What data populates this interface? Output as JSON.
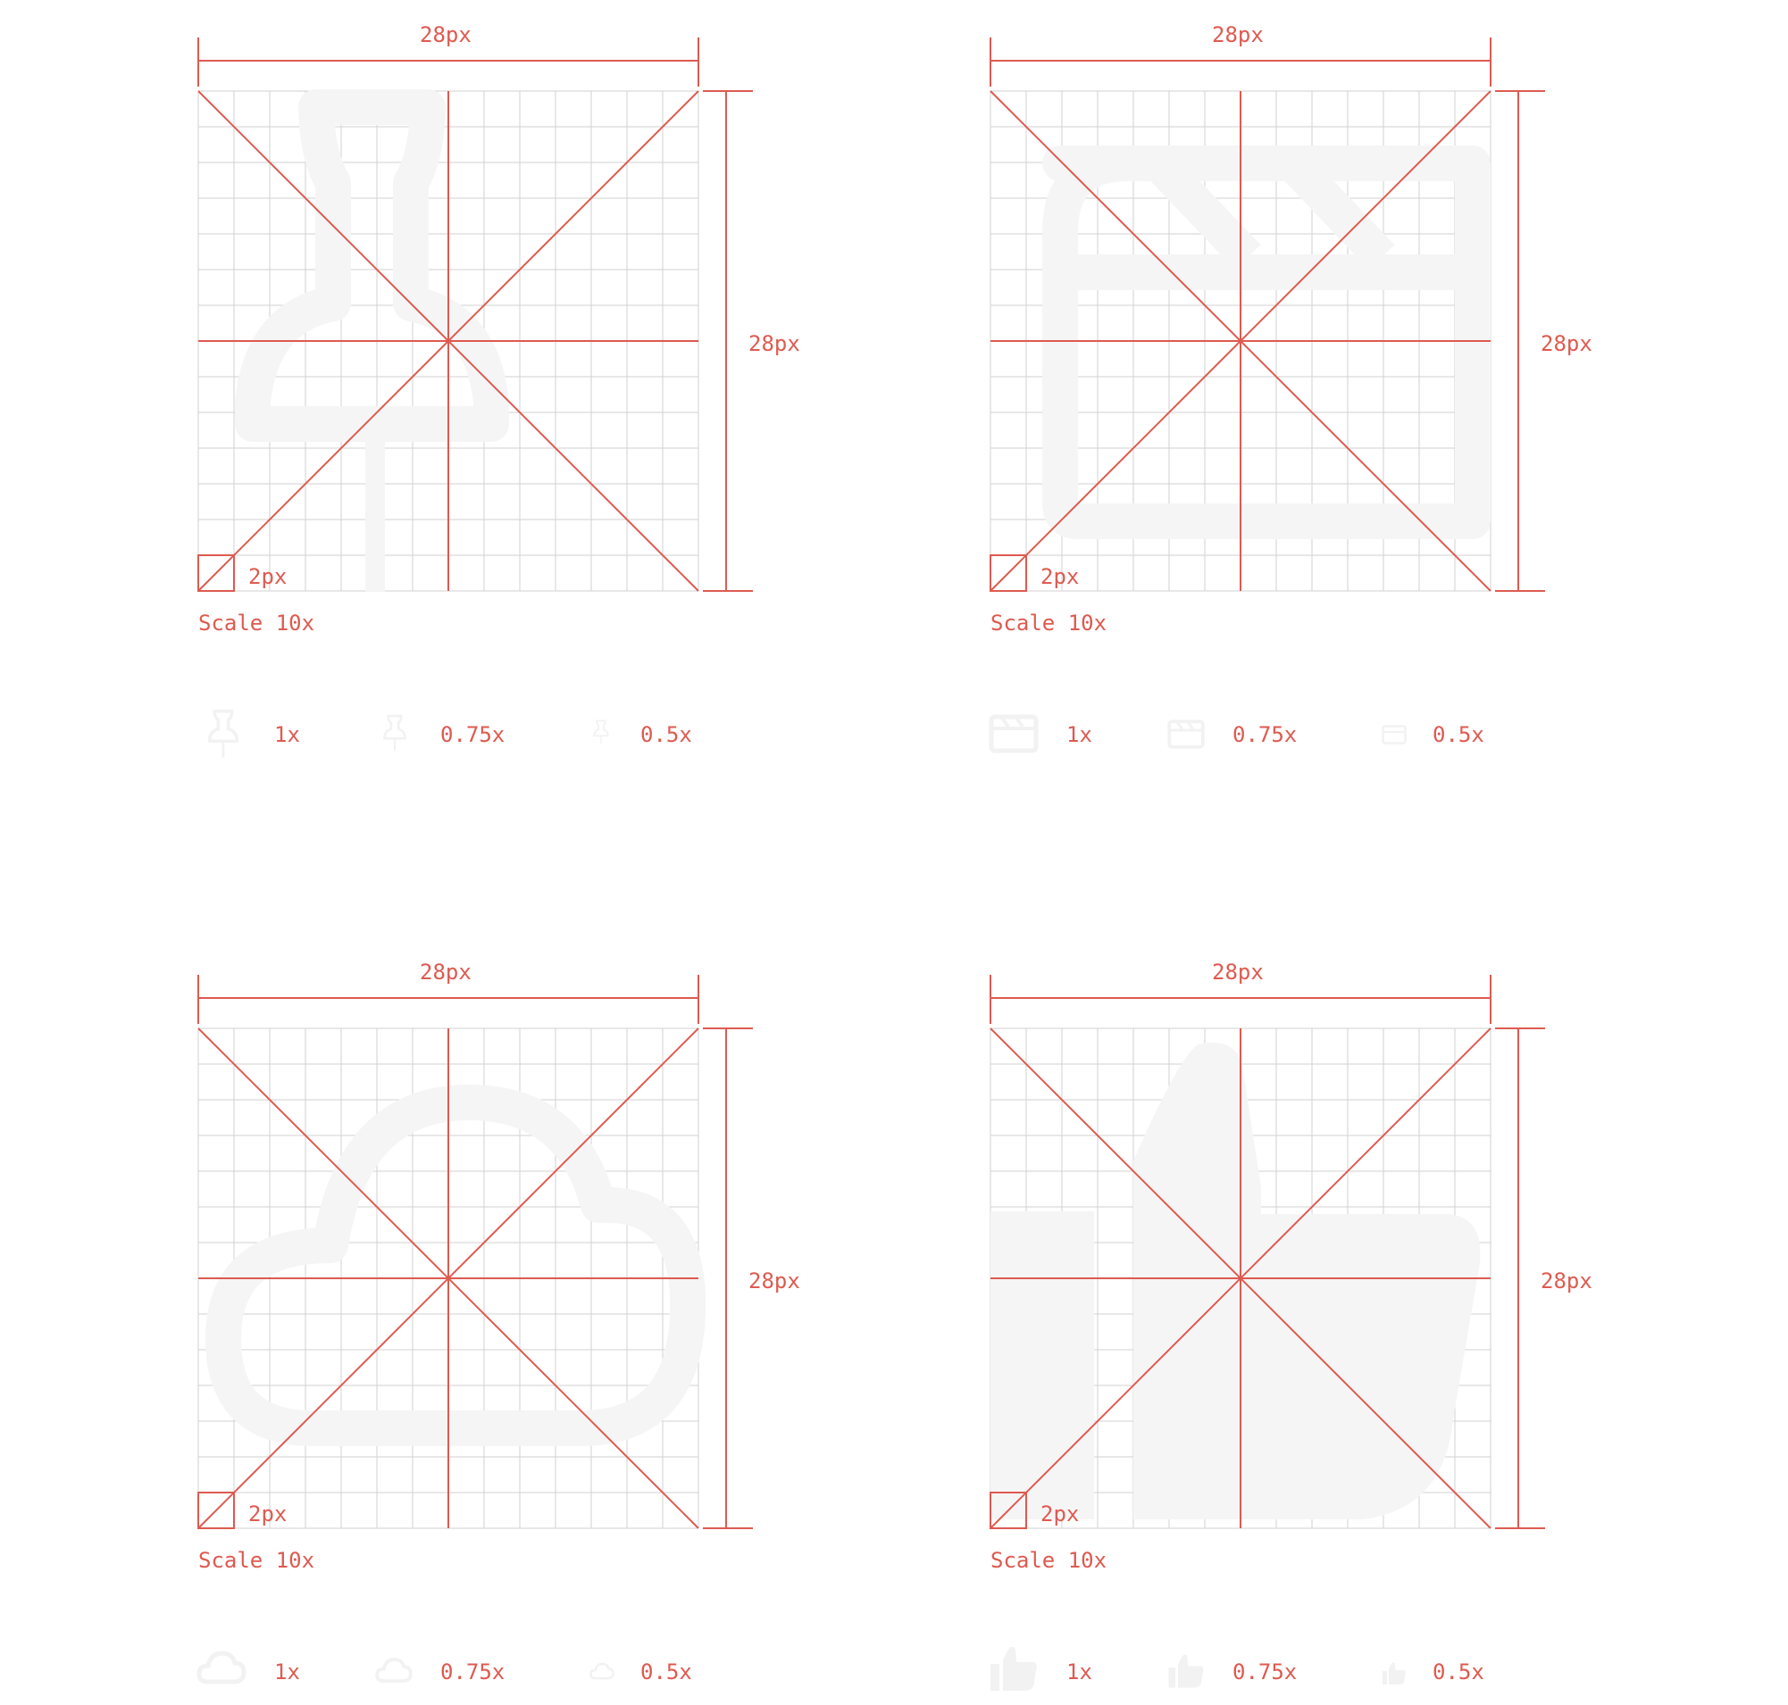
{
  "accent_color": "#de5a50",
  "grid_color": "#d2d2d2",
  "glyph_color": "#f5f5f5",
  "panels": [
    {
      "icon": "pushpin-icon",
      "width_label": "28px",
      "height_label": "28px",
      "stroke_label": "2px",
      "scale_label": "Scale 10x",
      "previews": [
        {
          "label": "1x"
        },
        {
          "label": "0.75x"
        },
        {
          "label": "0.5x"
        }
      ]
    },
    {
      "icon": "clapperboard-icon",
      "width_label": "28px",
      "height_label": "28px",
      "stroke_label": "2px",
      "scale_label": "Scale 10x",
      "previews": [
        {
          "label": "1x"
        },
        {
          "label": "0.75x"
        },
        {
          "label": "0.5x"
        }
      ]
    },
    {
      "icon": "cloud-icon",
      "width_label": "28px",
      "height_label": "28px",
      "stroke_label": "2px",
      "scale_label": "Scale 10x",
      "previews": [
        {
          "label": "1x"
        },
        {
          "label": "0.75x"
        },
        {
          "label": "0.5x"
        }
      ]
    },
    {
      "icon": "thumbs-up-icon",
      "width_label": "28px",
      "height_label": "28px",
      "stroke_label": "2px",
      "scale_label": "Scale 10x",
      "previews": [
        {
          "label": "1x"
        },
        {
          "label": "0.75x"
        },
        {
          "label": "0.5x"
        }
      ]
    }
  ]
}
